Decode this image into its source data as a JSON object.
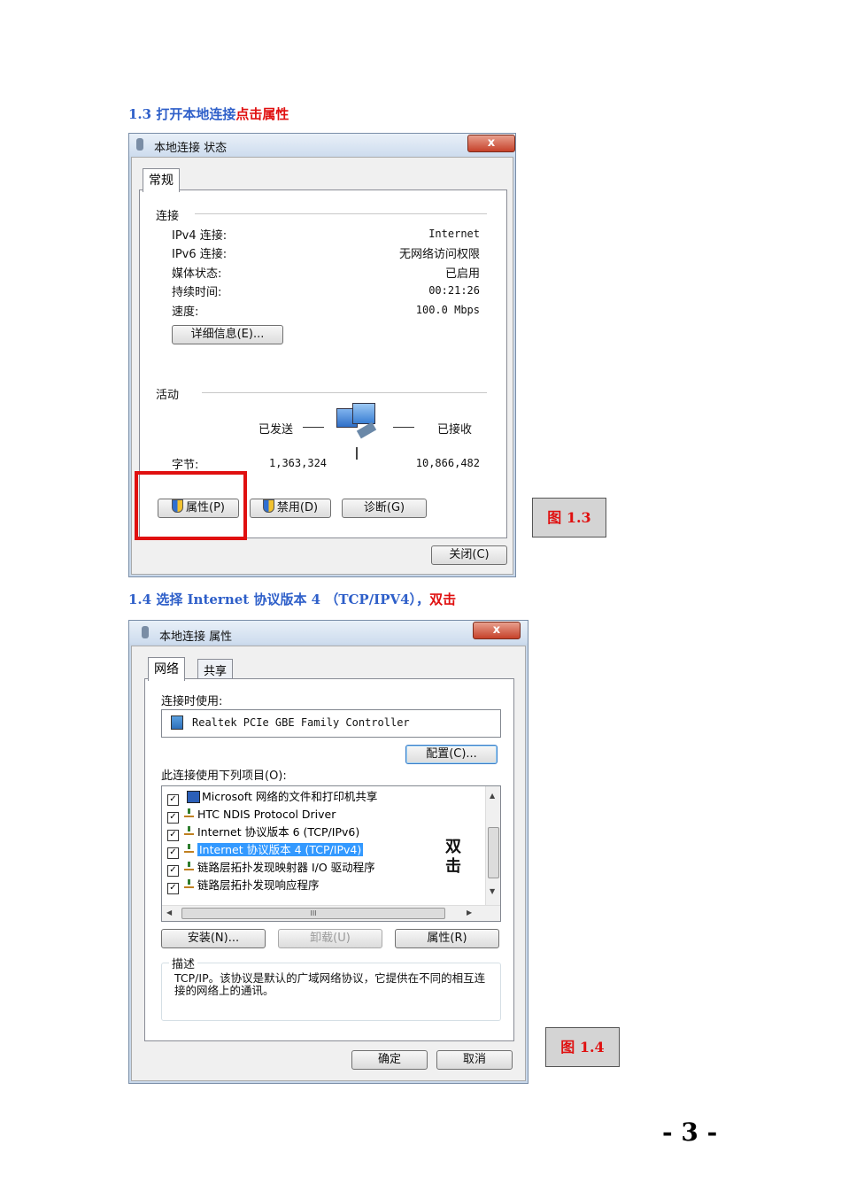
{
  "section13": {
    "number": "1.3",
    "blue_text": "打开本地连接",
    "red_text": "点击属性"
  },
  "status_dialog": {
    "title": "本地连接 状态",
    "close": "x",
    "tab": "常规",
    "connection_group": "连接",
    "rows": [
      {
        "label": "IPv4 连接:",
        "value": "Internet"
      },
      {
        "label": "IPv6 连接:",
        "value": "无网络访问权限"
      },
      {
        "label": "媒体状态:",
        "value": "已启用"
      },
      {
        "label": "持续时间:",
        "value": "00:21:26"
      },
      {
        "label": "速度:",
        "value": "100.0 Mbps"
      }
    ],
    "details_button": "详细信息(E)...",
    "activity_group": "活动",
    "sent_label": "已发送",
    "recv_label": "已接收",
    "bytes_label": "字节:",
    "bytes_sent": "1,363,324",
    "bytes_recv": "10,866,482",
    "properties_button": "属性(P)",
    "disable_button": "禁用(D)",
    "diagnose_button": "诊断(G)",
    "close_button": "关闭(C)"
  },
  "fig13": "图 1.3",
  "section14": {
    "blue_text": "1.4 选择 Internet 协议版本 4 （TCP/IPV4），",
    "red_text": "双击"
  },
  "props_dialog": {
    "title": "本地连接 属性",
    "close": "x",
    "tab_network": "网络",
    "tab_sharing": "共享",
    "connect_using_label": "连接时使用:",
    "adapter": "Realtek PCIe GBE Family Controller",
    "configure_button": "配置(C)...",
    "items_label": "此连接使用下列项目(O):",
    "items": [
      "Microsoft 网络的文件和打印机共享",
      "HTC NDIS Protocol Driver",
      "Internet 协议版本 6 (TCP/IPv6)",
      "Internet 协议版本 4 (TCP/IPv4)",
      "链路层拓扑发现映射器 I/O 驱动程序",
      "链路层拓扑发现响应程序"
    ],
    "annotation_line1": "双",
    "annotation_line2": "击",
    "hscroll_mark": "III",
    "install_button": "安装(N)...",
    "uninstall_button": "卸载(U)",
    "properties_button": "属性(R)",
    "description_group": "描述",
    "description": "TCP/IP。该协议是默认的广域网络协议，它提供在不同的相互连接的网络上的通讯。",
    "ok_button": "确定",
    "cancel_button": "取消"
  },
  "fig14": "图 1.4",
  "page_number": "- 3 -"
}
